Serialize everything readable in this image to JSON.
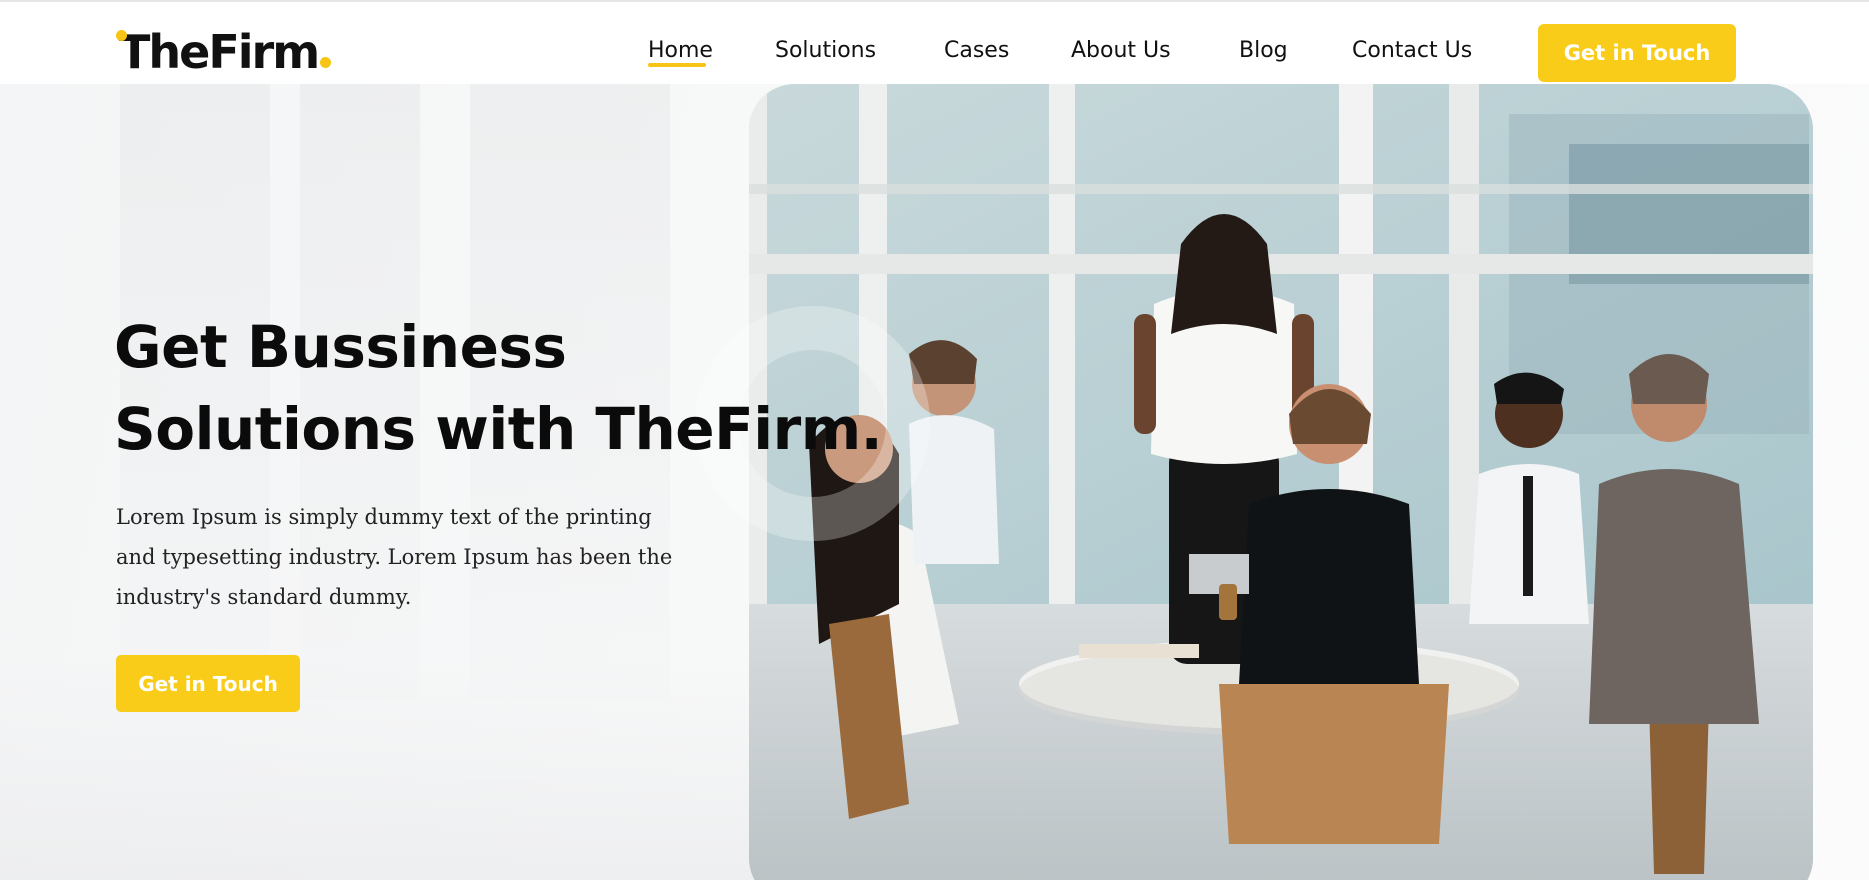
{
  "brand": {
    "name": "TheFirm",
    "accent_color": "#f8cc19"
  },
  "nav": {
    "items": [
      {
        "label": "Home",
        "active": true
      },
      {
        "label": "Solutions",
        "active": false
      },
      {
        "label": "Cases",
        "active": false
      },
      {
        "label": "About Us",
        "active": false
      },
      {
        "label": "Blog",
        "active": false
      },
      {
        "label": "Contact Us",
        "active": false
      }
    ],
    "cta_label": "Get in Touch"
  },
  "hero": {
    "heading_line1": "Get Bussiness",
    "heading_line2": "Solutions with TheFirm.",
    "description": "Lorem Ipsum is simply dummy text of the printing and typesetting industry. Lorem Ipsum has been the industry's standard dummy.",
    "cta_label": "Get in Touch",
    "image": "business-meeting-photo"
  }
}
